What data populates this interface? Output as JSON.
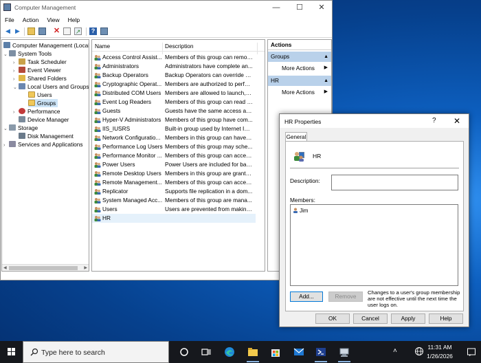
{
  "window": {
    "title": "Computer Management",
    "controls": {
      "minimize": "—",
      "maximize": "☐",
      "close": "✕"
    }
  },
  "menu": [
    "File",
    "Action",
    "View",
    "Help"
  ],
  "tree": [
    {
      "label": "Computer Management (Local",
      "icon": "computer-management-icon"
    },
    {
      "label": "System Tools",
      "icon": "system-tools-icon"
    },
    {
      "label": "Task Scheduler",
      "icon": "task-scheduler-icon"
    },
    {
      "label": "Event Viewer",
      "icon": "event-viewer-icon"
    },
    {
      "label": "Shared Folders",
      "icon": "shared-folders-icon"
    },
    {
      "label": "Local Users and Groups",
      "icon": "local-users-groups-icon"
    },
    {
      "label": "Users",
      "icon": "folder-icon"
    },
    {
      "label": "Groups",
      "icon": "folder-icon"
    },
    {
      "label": "Performance",
      "icon": "performance-icon"
    },
    {
      "label": "Device Manager",
      "icon": "device-manager-icon"
    },
    {
      "label": "Storage",
      "icon": "storage-icon"
    },
    {
      "label": "Disk Management",
      "icon": "disk-management-icon"
    },
    {
      "label": "Services and Applications",
      "icon": "services-icon"
    }
  ],
  "list": {
    "columns": [
      "Name",
      "Description"
    ],
    "rows": [
      {
        "name": "Access Control Assist...",
        "desc": "Members of this group can remot..."
      },
      {
        "name": "Administrators",
        "desc": "Administrators have complete an..."
      },
      {
        "name": "Backup Operators",
        "desc": "Backup Operators can override se..."
      },
      {
        "name": "Cryptographic Operat...",
        "desc": "Members are authorized to perfor..."
      },
      {
        "name": "Distributed COM Users",
        "desc": "Members are allowed to launch, a..."
      },
      {
        "name": "Event Log Readers",
        "desc": "Members of this group can read e..."
      },
      {
        "name": "Guests",
        "desc": "Guests have the same access as m..."
      },
      {
        "name": "Hyper-V Administrators",
        "desc": "Members of this group have com..."
      },
      {
        "name": "IIS_IUSRS",
        "desc": "Built-in group used by Internet Inf..."
      },
      {
        "name": "Network Configuratio...",
        "desc": "Members in this group can have s..."
      },
      {
        "name": "Performance Log Users",
        "desc": "Members of this group may sche..."
      },
      {
        "name": "Performance Monitor ...",
        "desc": "Members of this group can acces..."
      },
      {
        "name": "Power Users",
        "desc": "Power Users are included for back..."
      },
      {
        "name": "Remote Desktop Users",
        "desc": "Members in this group are grante..."
      },
      {
        "name": "Remote Management...",
        "desc": "Members of this group can acces..."
      },
      {
        "name": "Replicator",
        "desc": "Supports file replication in a dom..."
      },
      {
        "name": "System Managed Acc...",
        "desc": "Members of this group are mana..."
      },
      {
        "name": "Users",
        "desc": "Users are prevented from making ..."
      },
      {
        "name": "HR",
        "desc": ""
      }
    ]
  },
  "actions": {
    "header": "Actions",
    "sections": [
      {
        "title": "Groups",
        "item": "More Actions"
      },
      {
        "title": "HR",
        "item": "More Actions"
      }
    ]
  },
  "dialog": {
    "title": "HR Properties",
    "help": "?",
    "close": "✕",
    "tab": "General",
    "group_name": "HR",
    "description_label": "Description:",
    "description_value": "",
    "members_label": "Members:",
    "members": [
      "Jim"
    ],
    "add_label": "Add...",
    "remove_label": "Remove",
    "note": "Changes to a user's group membership are not effective until the next time the user logs on.",
    "ok_label": "OK",
    "cancel_label": "Cancel",
    "apply_label": "Apply",
    "help_label": "Help"
  },
  "taskbar": {
    "search_placeholder": "Type here to search",
    "time": "11:31 AM",
    "date": "1/26/2026"
  },
  "colors": {
    "selection": "#cce4f7",
    "action_section": "#b9d1ea",
    "taskbar": "#16181d",
    "accent": "#0078d7"
  }
}
